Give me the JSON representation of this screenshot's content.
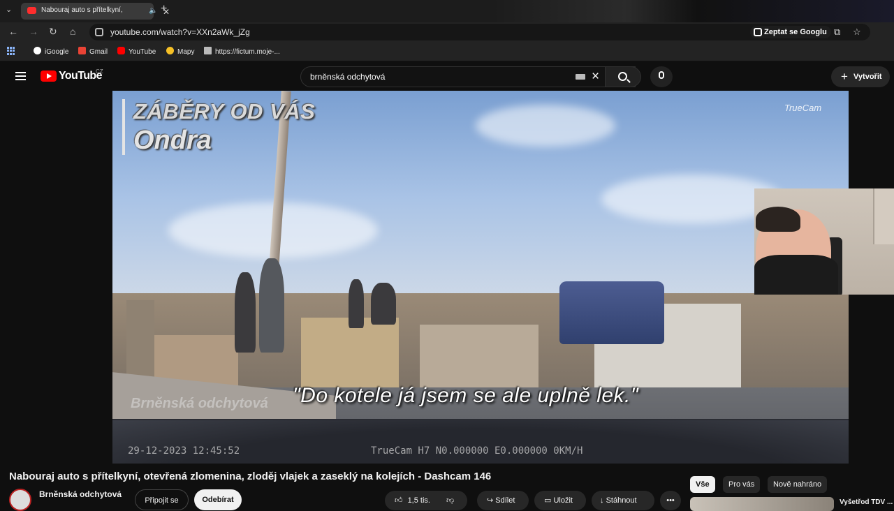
{
  "browser": {
    "tab_title": "Nabouraj auto s přítelkyní,",
    "url": "youtube.com/watch?v=XXn2aWk_jZg",
    "ask_google": "Zeptat se Googlu",
    "bookmarks": [
      "iGoogle",
      "Gmail",
      "YouTube",
      "Mapy",
      "https://fictum.moje-..."
    ]
  },
  "header": {
    "logo_text": "YouTube",
    "country": "CZ",
    "search_value": "brněnská odchytová",
    "create_label": "Vytvořit"
  },
  "video": {
    "overlay_line1": "ZÁBĚRY OD VÁS",
    "overlay_line2": "Ondra",
    "cam_logo": "TrueCam",
    "quote": "\"Do kotele já jsem se ale uplně lek.\"",
    "watermark": "Brněnská odchytová",
    "timestamp": "29-12-2023 12:45:52",
    "cam_info": "TrueCam H7 N0.000000 E0.000000 0KM/H"
  },
  "meta": {
    "title": "Nabouraj auto s přítelkyní, otevřená zlomenina, zloděj vlajek a zaseklý na kolejích - Dashcam 146",
    "channel": "Brněnská odchytová",
    "join_label": "Připojit se",
    "subscribe_label": "Odebírat",
    "likes": "1,5 tis.",
    "share_label": "Sdílet",
    "save_label": "Uložit",
    "download_label": "Stáhnout"
  },
  "chips": [
    "Vše",
    "Pro vás",
    "Nově nahráno"
  ],
  "related_title": "Vyšetřod TDV ..."
}
